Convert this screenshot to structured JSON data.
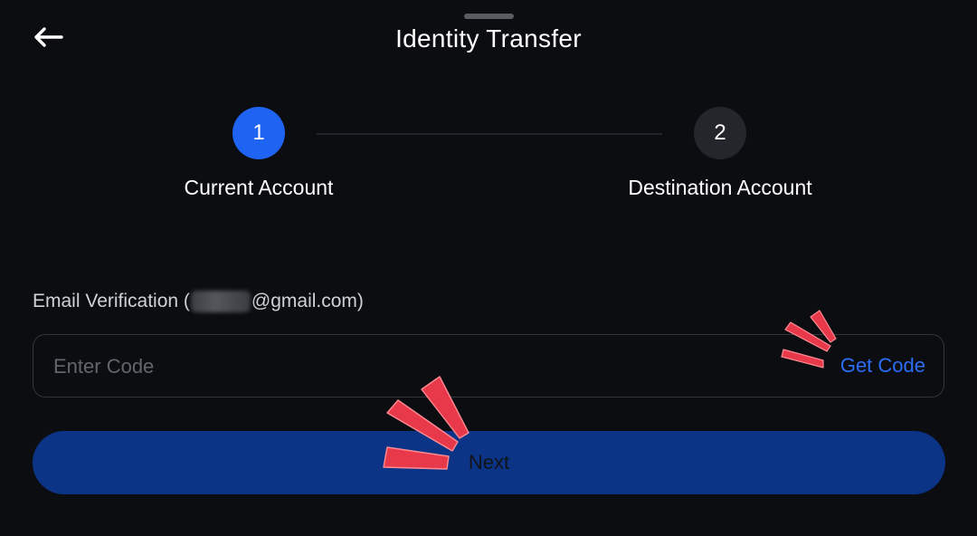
{
  "header": {
    "title": "Identity Transfer",
    "back_icon": "arrow-left-icon"
  },
  "stepper": {
    "steps": [
      {
        "number": "1",
        "label": "Current Account",
        "state": "active",
        "color": "#1f63f2"
      },
      {
        "number": "2",
        "label": "Destination Account",
        "state": "inactive",
        "color": "#24262b"
      }
    ]
  },
  "form": {
    "label_prefix": "Email Verification (",
    "label_suffix": "@gmail.com)",
    "code_placeholder": "Enter Code",
    "code_value": "",
    "get_code_label": "Get Code",
    "get_code_color": "#2b6ef5"
  },
  "next_button": {
    "label": "Next",
    "color": "#0b3487"
  },
  "annotations": {
    "highlight_color": "#e8394a",
    "burst_icon": "attention-burst-icon"
  }
}
